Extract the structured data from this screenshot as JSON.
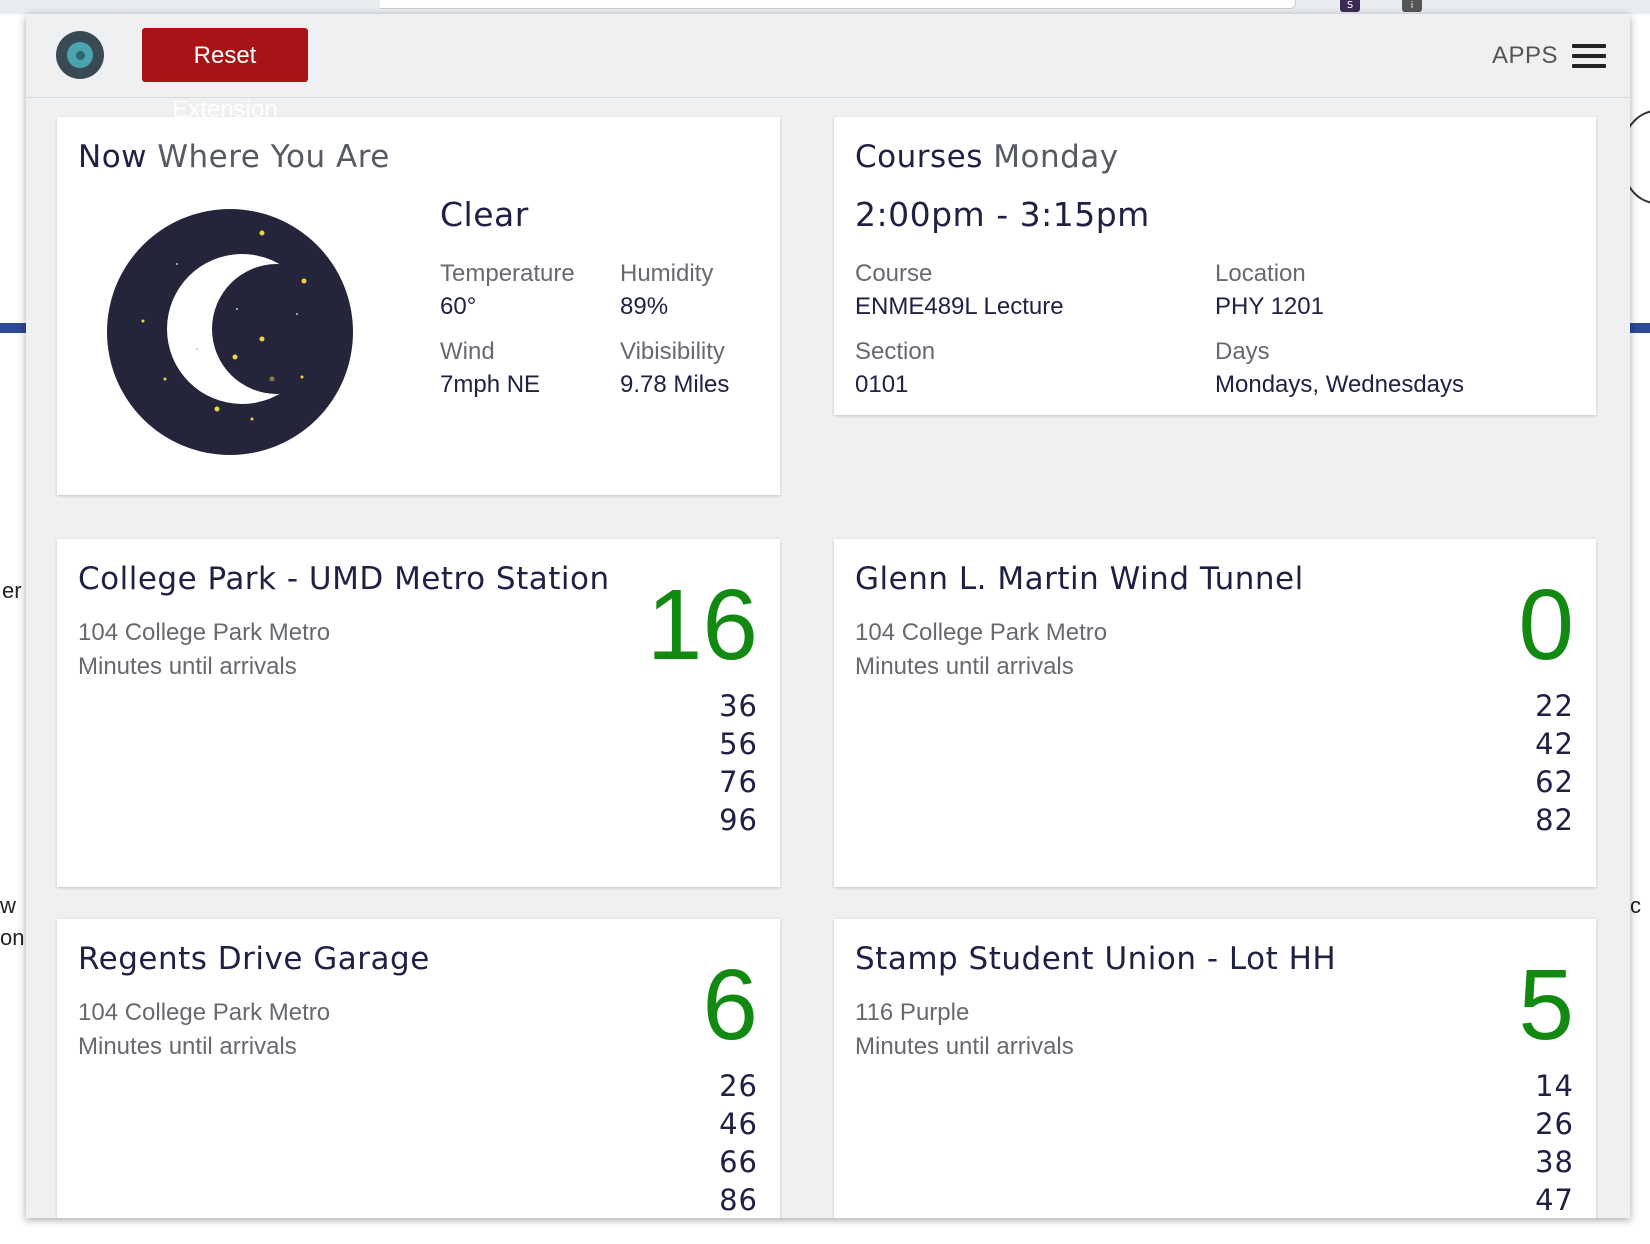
{
  "header": {
    "reset_label": "Reset Extension",
    "apps_label": "APPS"
  },
  "weather": {
    "title_strong": "Now",
    "title_muted": "Where You Are",
    "condition": "Clear",
    "temperature_label": "Temperature",
    "temperature_value": "60°",
    "humidity_label": "Humidity",
    "humidity_value": "89%",
    "wind_label": "Wind",
    "wind_value": "7mph NE",
    "visibility_label": "Vibisibility",
    "visibility_value": "9.78 Miles",
    "icon": "clear-night-moon"
  },
  "courses": {
    "title_strong": "Courses",
    "title_muted": "Monday",
    "time": "2:00pm - 3:15pm",
    "course_label": "Course",
    "course_value": "ENME489L Lecture",
    "location_label": "Location",
    "location_value": "PHY 1201",
    "section_label": "Section",
    "section_value": "0101",
    "days_label": "Days",
    "days_value": "Mondays, Wednesdays"
  },
  "stops": [
    {
      "name": "College Park - UMD Metro Station",
      "route": "104 College Park Metro",
      "caption": "Minutes until arrivals",
      "next": "16",
      "later": [
        "36",
        "56",
        "76",
        "96"
      ]
    },
    {
      "name": "Glenn L. Martin Wind Tunnel",
      "route": "104 College Park Metro",
      "caption": "Minutes until arrivals",
      "next": "0",
      "later": [
        "22",
        "42",
        "62",
        "82"
      ]
    },
    {
      "name": "Regents Drive Garage",
      "route": "104 College Park Metro",
      "caption": "Minutes until arrivals",
      "next": "6",
      "later": [
        "26",
        "46",
        "66",
        "86"
      ]
    },
    {
      "name": "Stamp Student Union - Lot HH",
      "route": "116 Purple",
      "caption": "Minutes until arrivals",
      "next": "5",
      "later": [
        "14",
        "26",
        "38",
        "47"
      ]
    }
  ],
  "colors": {
    "accent_green": "#128a12",
    "reset_red": "#a81415",
    "title_navy": "#1e2044"
  }
}
